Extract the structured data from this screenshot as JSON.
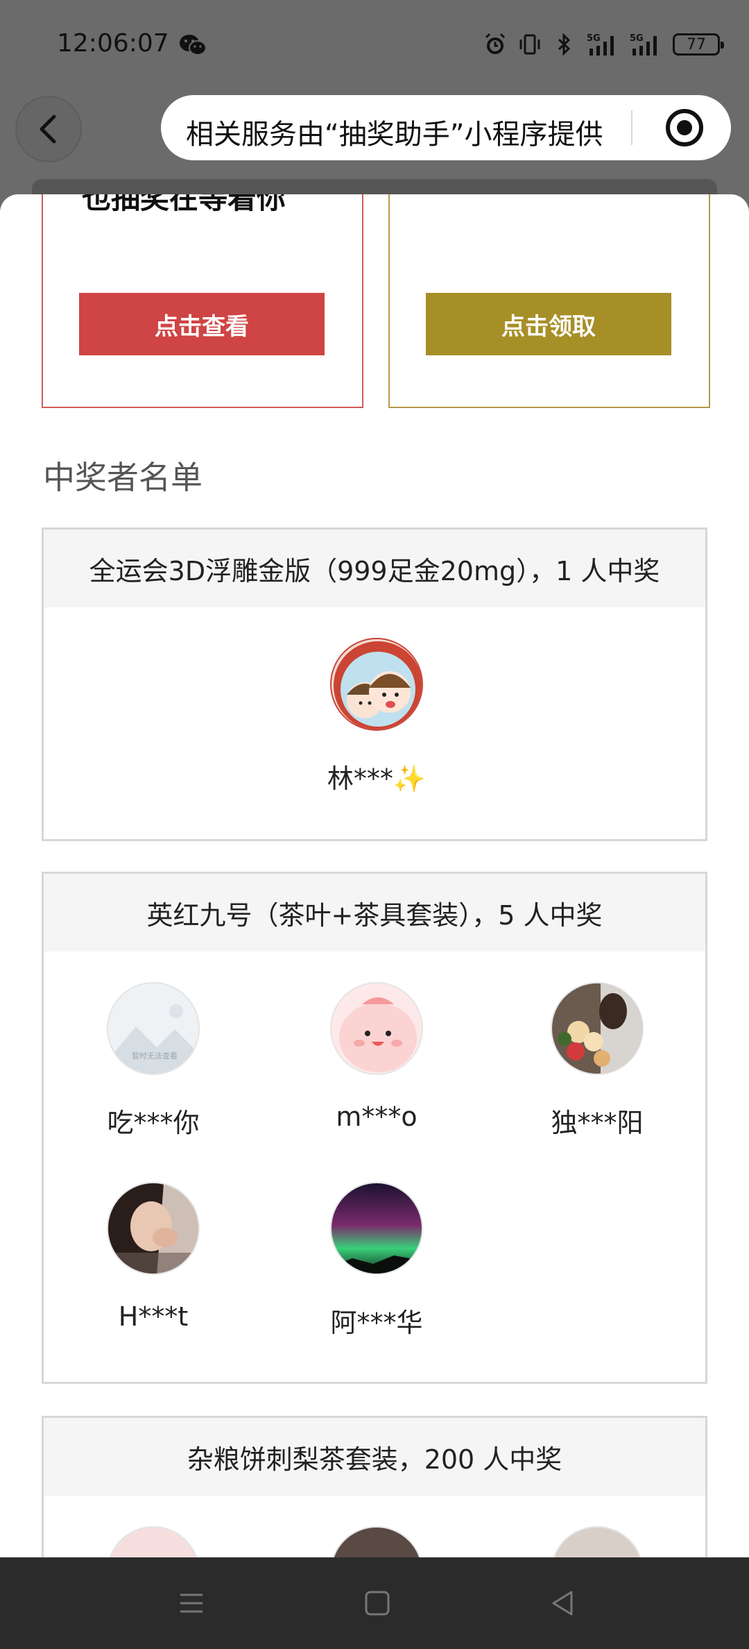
{
  "status_bar": {
    "time": "12:06:07",
    "battery": "77",
    "icons": [
      "wechat-icon",
      "alarm-icon",
      "vibrate-icon",
      "bluetooth-icon",
      "signal-5g-icon",
      "signal-5g-icon"
    ]
  },
  "header": {
    "service_text": "相关服务由“抽奖助手”小程序提供",
    "back_icon": "chevron-left-icon",
    "menu_icon": "target-icon"
  },
  "action_cards": {
    "left": {
      "heading": "也抽奖在等着你",
      "button": "点击查看",
      "color": "#cf4444"
    },
    "right": {
      "heading": "",
      "button": "点击领取",
      "color": "#a78f27"
    }
  },
  "winners_title": "中奖者名单",
  "prizes": [
    {
      "title": "全运会3D浮雕金版（999足金20mg），1 人中奖",
      "winners": [
        {
          "name": "林***✨",
          "avatar": "cartoon-couple-avatar"
        }
      ]
    },
    {
      "title": "英红九号（茶叶+茶具套装），5 人中奖",
      "winners": [
        {
          "name": "吃***你",
          "avatar": "placeholder-avatar",
          "avatar_text": "暂时无法查看"
        },
        {
          "name": "m***o",
          "avatar": "pink-cartoon-avatar"
        },
        {
          "name": "独***阳",
          "avatar": "flowers-photo-avatar"
        },
        {
          "name": "H***t",
          "avatar": "girl-photo-avatar"
        },
        {
          "name": "阿***华",
          "avatar": "aurora-photo-avatar"
        }
      ]
    },
    {
      "title": "杂粮饼刺梨茶套装，200 人中奖",
      "winners": [
        {
          "name": "",
          "avatar": "pig-cartoon-avatar"
        },
        {
          "name": "",
          "avatar": "dark-photo-avatar"
        },
        {
          "name": "",
          "avatar": "child-photo-avatar"
        }
      ]
    }
  ],
  "nav_bar": {
    "icons": [
      "menu-icon",
      "home-icon",
      "back-icon"
    ]
  }
}
